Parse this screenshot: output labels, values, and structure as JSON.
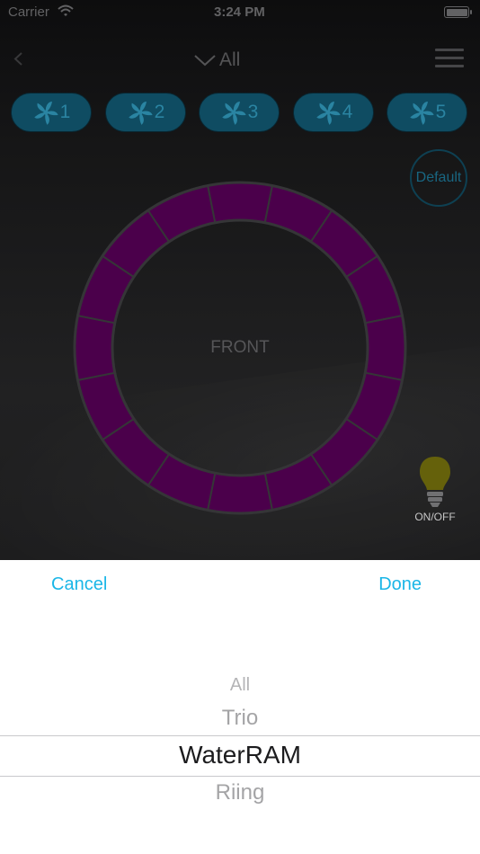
{
  "status_bar": {
    "carrier": "Carrier",
    "time": "3:24 PM"
  },
  "nav": {
    "title": "All",
    "icons": [
      "back-chevron-icon",
      "chevron-down-icon",
      "hamburger-menu-icon"
    ]
  },
  "fans": [
    {
      "label": "1",
      "icon": "fan-icon"
    },
    {
      "label": "2",
      "icon": "fan-icon"
    },
    {
      "label": "3",
      "icon": "fan-icon"
    },
    {
      "label": "4",
      "icon": "fan-icon"
    },
    {
      "label": "5",
      "icon": "fan-icon"
    }
  ],
  "default_button": {
    "label": "Default"
  },
  "ring": {
    "center_label": "FRONT",
    "segment_count": 16,
    "segment_color": "#520052"
  },
  "light": {
    "label": "ON/OFF",
    "icon": "lightbulb-icon",
    "color": "#6e6a0c"
  },
  "picker_sheet": {
    "cancel_label": "Cancel",
    "done_label": "Done",
    "options": [
      "All",
      "Trio",
      "WaterRAM",
      "Riing"
    ],
    "selected": "WaterRAM",
    "accent_color": "#1ab6e7"
  },
  "colors": {
    "fan_button_fill": "#11536b",
    "fan_button_text": "#2e90b0"
  }
}
